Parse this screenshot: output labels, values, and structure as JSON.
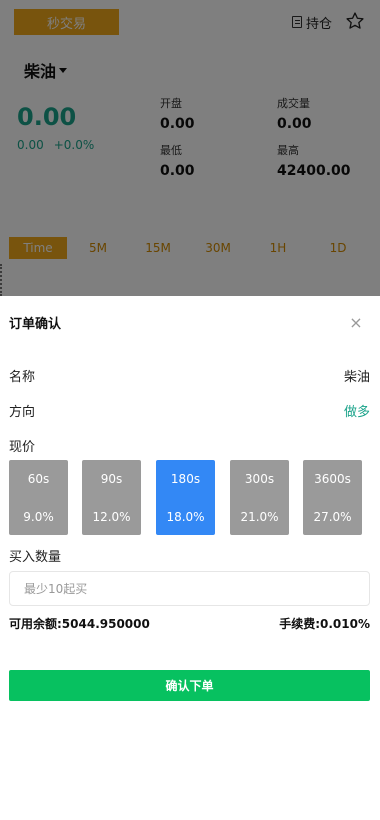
{
  "background": {
    "mode_button": "秒交易",
    "positions_label": "持仓",
    "symbol": "柴油",
    "last_price": "0.00",
    "change_abs": "0.00",
    "change_pct": "+0.0%",
    "stats": {
      "open_label": "开盘",
      "open_value": "0.00",
      "volume_label": "成交量",
      "volume_value": "0.00",
      "low_label": "最低",
      "low_value": "0.00",
      "high_label": "最高",
      "high_value": "42400.00"
    },
    "timeframes": [
      "Time",
      "5M",
      "15M",
      "30M",
      "1H",
      "1D"
    ],
    "active_timeframe": "Time"
  },
  "sheet": {
    "title": "订单确认",
    "close": "×",
    "name_label": "名称",
    "name_value": "柴油",
    "direction_label": "方向",
    "direction_value": "做多",
    "price_label": "现价",
    "options": [
      {
        "time": "60s",
        "rate": "9.0%",
        "selected": false
      },
      {
        "time": "90s",
        "rate": "12.0%",
        "selected": false
      },
      {
        "time": "180s",
        "rate": "18.0%",
        "selected": true
      },
      {
        "time": "300s",
        "rate": "21.0%",
        "selected": false
      },
      {
        "time": "3600s",
        "rate": "27.0%",
        "selected": false
      }
    ],
    "quantity_label": "买入数量",
    "quantity_placeholder": "最少10起买",
    "quantity_value": "",
    "balance": "可用余额:5044.950000",
    "fee": "手续费:0.010%",
    "confirm_button": "确认下单"
  },
  "colors": {
    "accent_orange": "#f0a81b",
    "up_green": "#1aa38a",
    "selected_blue": "#3388f5",
    "option_gray": "#9a9a9a",
    "confirm_green": "#07c160"
  }
}
